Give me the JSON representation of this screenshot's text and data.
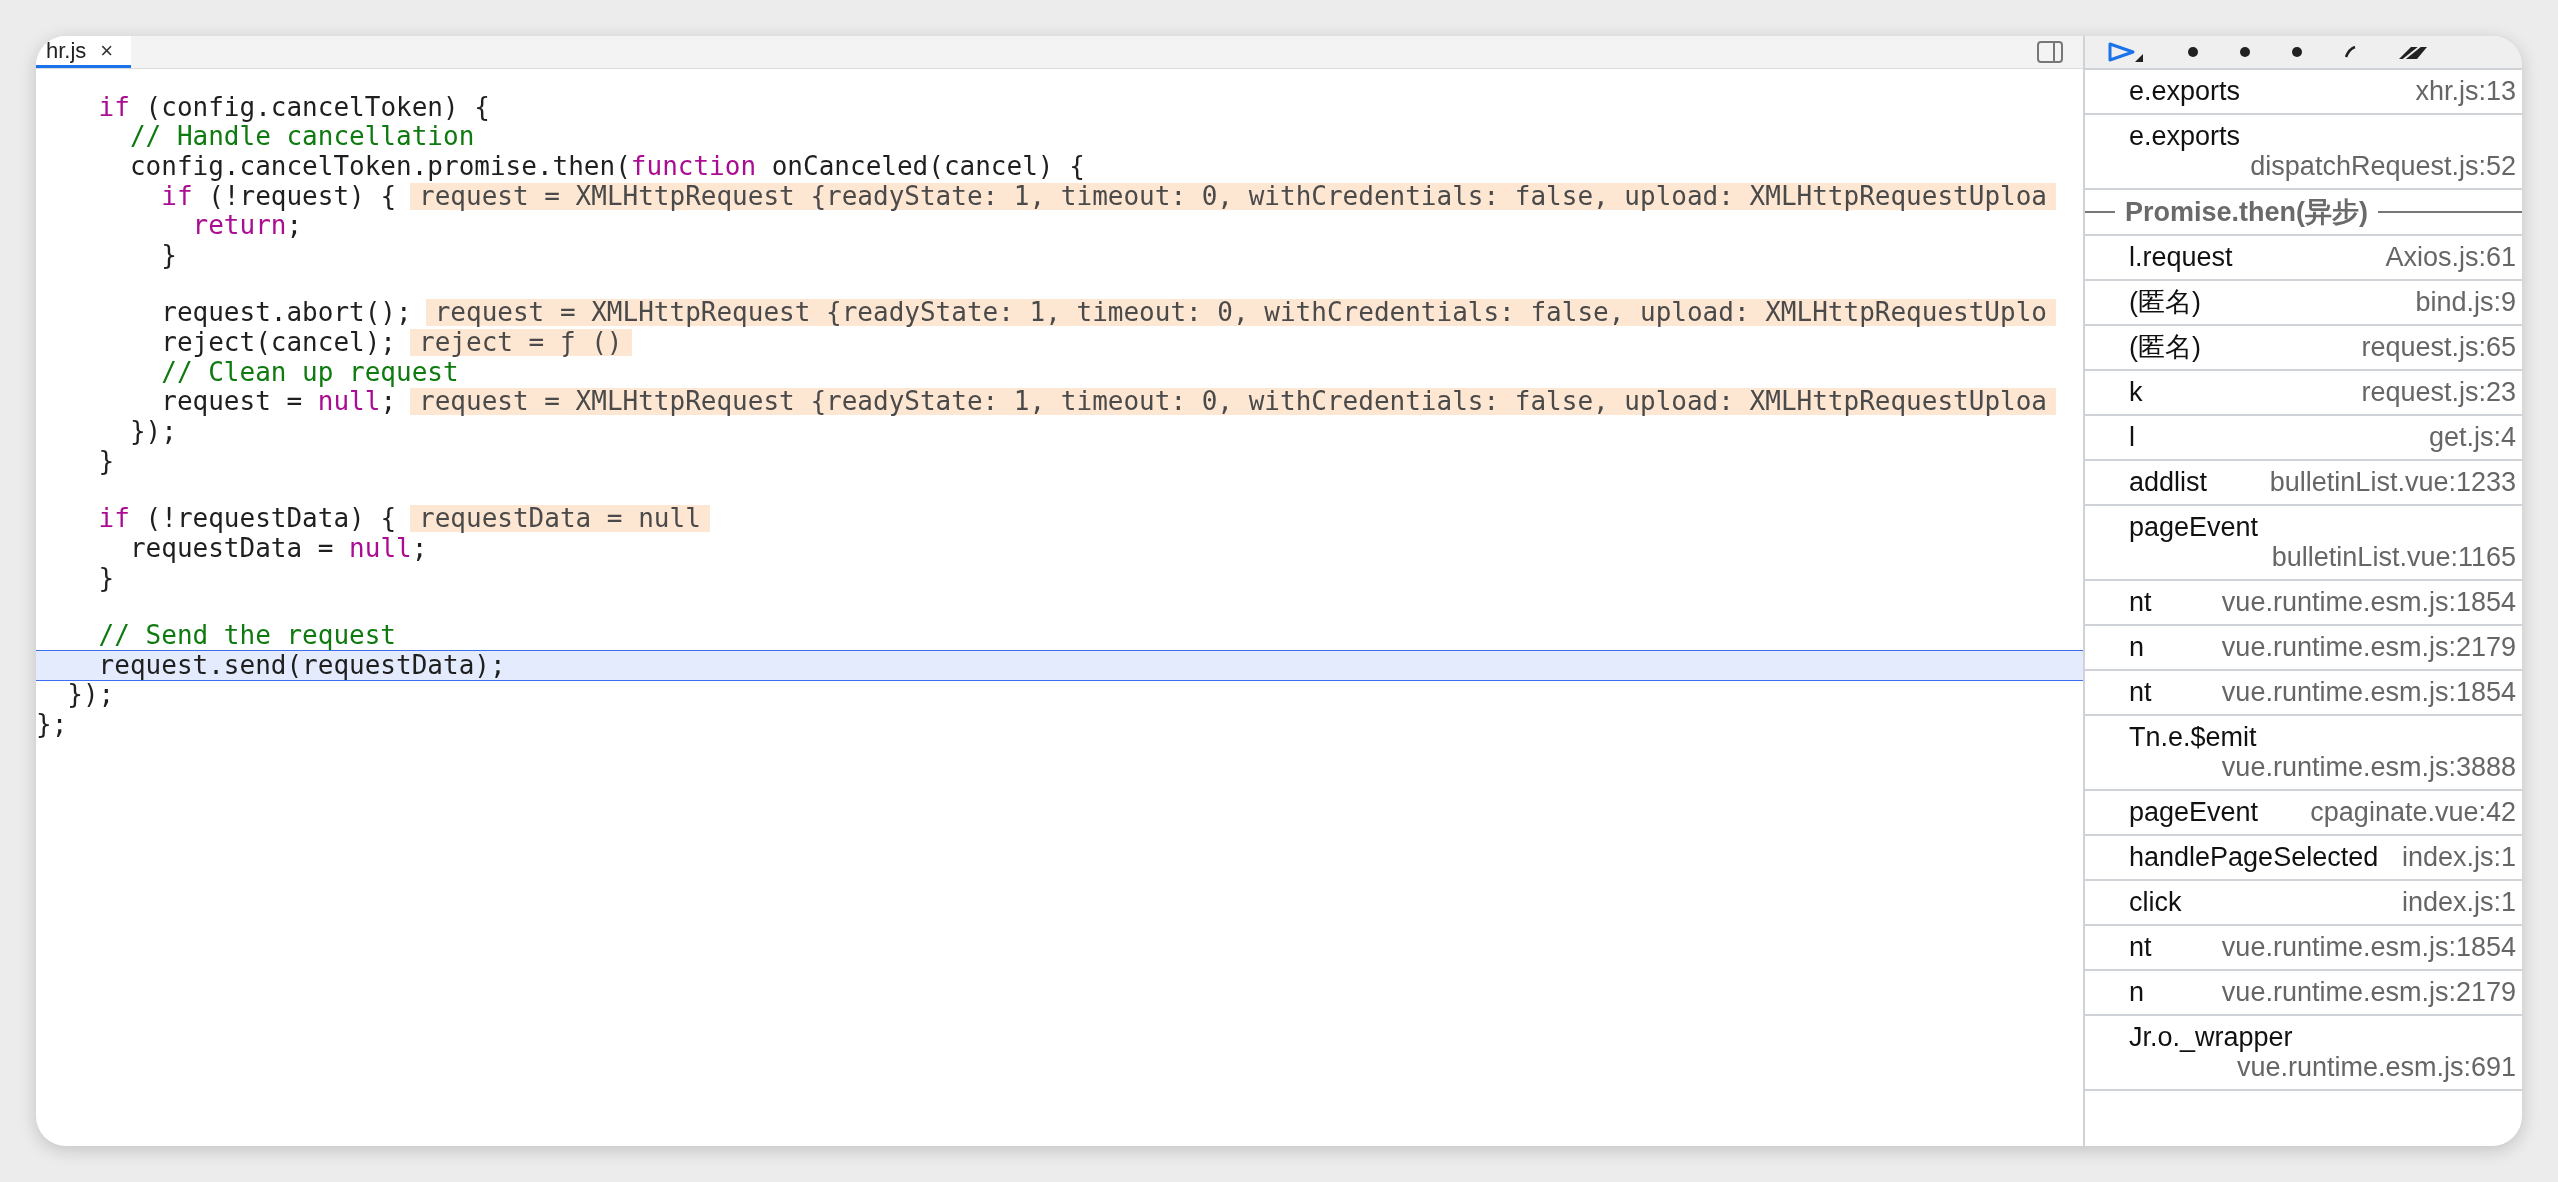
{
  "editor": {
    "tabs": [
      {
        "label": "hr.js",
        "close": "×",
        "selected": true
      }
    ],
    "code": {
      "lines": [
        {
          "kind": "code",
          "current": false,
          "tokens": [
            {
              "kind": "keyword",
              "text": "    if"
            },
            {
              "kind": "plain",
              "text": " (config.cancelToken) {"
            }
          ]
        },
        {
          "kind": "code",
          "current": false,
          "tokens": [
            {
              "kind": "comment",
              "text": "      // Handle cancellation"
            }
          ]
        },
        {
          "kind": "code",
          "current": false,
          "tokens": [
            {
              "kind": "plain",
              "text": "      config.cancelToken.promise.then("
            },
            {
              "kind": "keyword",
              "text": "function"
            },
            {
              "kind": "plain",
              "text": " onCanceled(cancel) {"
            }
          ]
        },
        {
          "kind": "code",
          "current": false,
          "tokens": [
            {
              "kind": "keyword",
              "text": "        if"
            },
            {
              "kind": "plain",
              "text": " (!request) {"
            }
          ],
          "value": "request = XMLHttpRequest {readyState: 1, timeout: 0, withCredentials: false, upload: XMLHttpRequestUploa"
        },
        {
          "kind": "code",
          "current": false,
          "tokens": [
            {
              "kind": "keyword",
              "text": "          return"
            },
            {
              "kind": "plain",
              "text": ";"
            }
          ]
        },
        {
          "kind": "code",
          "current": false,
          "tokens": [
            {
              "kind": "plain",
              "text": "        }"
            }
          ]
        },
        {
          "kind": "blank"
        },
        {
          "kind": "code",
          "current": false,
          "tokens": [
            {
              "kind": "plain",
              "text": "        request.abort();"
            }
          ],
          "value": "request = XMLHttpRequest {readyState: 1, timeout: 0, withCredentials: false, upload: XMLHttpRequestUplo"
        },
        {
          "kind": "code",
          "current": false,
          "tokens": [
            {
              "kind": "plain",
              "text": "        reject(cancel);"
            }
          ],
          "value": "reject = ƒ ()"
        },
        {
          "kind": "code",
          "current": false,
          "tokens": [
            {
              "kind": "comment",
              "text": "        // Clean up request"
            }
          ]
        },
        {
          "kind": "code",
          "current": false,
          "tokens": [
            {
              "kind": "plain",
              "text": "        request = "
            },
            {
              "kind": "keyword",
              "text": "null"
            },
            {
              "kind": "plain",
              "text": ";"
            }
          ],
          "value": "request = XMLHttpRequest {readyState: 1, timeout: 0, withCredentials: false, upload: XMLHttpRequestUploa"
        },
        {
          "kind": "code",
          "current": false,
          "tokens": [
            {
              "kind": "plain",
              "text": "      });"
            }
          ]
        },
        {
          "kind": "code",
          "current": false,
          "tokens": [
            {
              "kind": "plain",
              "text": "    }"
            }
          ]
        },
        {
          "kind": "blank"
        },
        {
          "kind": "code",
          "current": false,
          "tokens": [
            {
              "kind": "keyword",
              "text": "    if"
            },
            {
              "kind": "plain",
              "text": " (!requestData) {"
            }
          ],
          "value": "requestData = null"
        },
        {
          "kind": "code",
          "current": false,
          "tokens": [
            {
              "kind": "plain",
              "text": "      requestData = "
            },
            {
              "kind": "keyword",
              "text": "null"
            },
            {
              "kind": "plain",
              "text": ";"
            }
          ]
        },
        {
          "kind": "code",
          "current": false,
          "tokens": [
            {
              "kind": "plain",
              "text": "    }"
            }
          ]
        },
        {
          "kind": "blank"
        },
        {
          "kind": "code",
          "current": false,
          "tokens": [
            {
              "kind": "comment",
              "text": "    // Send the request"
            }
          ]
        },
        {
          "kind": "code",
          "current": true,
          "tokens": [
            {
              "kind": "plain",
              "text": "    request.send(requestData);"
            }
          ]
        },
        {
          "kind": "code",
          "current": false,
          "tokens": [
            {
              "kind": "plain",
              "text": "  });"
            }
          ]
        },
        {
          "kind": "code",
          "current": false,
          "tokens": [
            {
              "kind": "plain",
              "text": "};"
            }
          ]
        }
      ]
    }
  },
  "call_stack": {
    "frames": [
      {
        "kind": "frame",
        "name": "e.exports",
        "location": "xhr.js:13"
      },
      {
        "kind": "frame",
        "name": "e.exports",
        "location": "dispatchRequest.js:52"
      },
      {
        "kind": "async",
        "name": "Promise.then(异步)"
      },
      {
        "kind": "frame",
        "name": "l.request",
        "location": "Axios.js:61"
      },
      {
        "kind": "frame",
        "name": "(匿名)",
        "location": "bind.js:9"
      },
      {
        "kind": "frame",
        "name": "(匿名)",
        "location": "request.js:65"
      },
      {
        "kind": "frame",
        "name": "k",
        "location": "request.js:23"
      },
      {
        "kind": "frame",
        "name": "l",
        "location": "get.js:4"
      },
      {
        "kind": "frame",
        "name": "addlist",
        "location": "bulletinList.vue:1233"
      },
      {
        "kind": "frame",
        "name": "pageEvent",
        "location": "bulletinList.vue:1165"
      },
      {
        "kind": "frame",
        "name": "nt",
        "location": "vue.runtime.esm.js:1854"
      },
      {
        "kind": "frame",
        "name": "n",
        "location": "vue.runtime.esm.js:2179"
      },
      {
        "kind": "frame",
        "name": "nt",
        "location": "vue.runtime.esm.js:1854"
      },
      {
        "kind": "frame",
        "name": "Tn.e.$emit",
        "location": "vue.runtime.esm.js:3888"
      },
      {
        "kind": "frame",
        "name": "pageEvent",
        "location": "cpaginate.vue:42"
      },
      {
        "kind": "frame",
        "name": "handlePageSelected",
        "location": "index.js:1"
      },
      {
        "kind": "frame",
        "name": "click",
        "location": "index.js:1"
      },
      {
        "kind": "frame",
        "name": "nt",
        "location": "vue.runtime.esm.js:1854"
      },
      {
        "kind": "frame",
        "name": "n",
        "location": "vue.runtime.esm.js:2179"
      },
      {
        "kind": "frame",
        "name": "Jr.o._wrapper",
        "location": "vue.runtime.esm.js:691"
      }
    ]
  }
}
